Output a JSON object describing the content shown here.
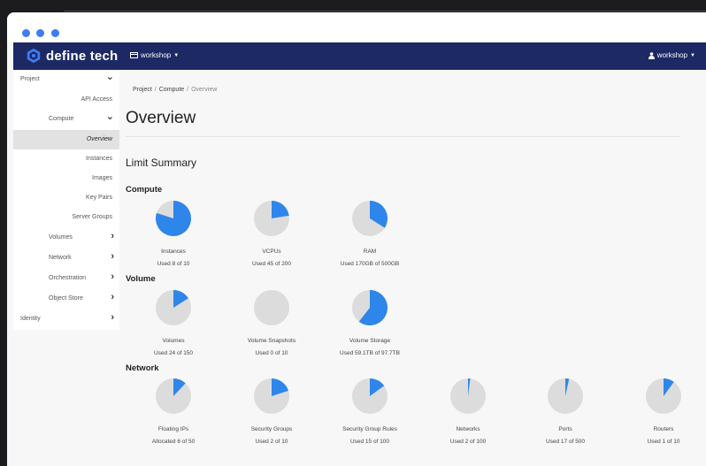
{
  "window": {
    "controls": [
      "close",
      "minimize",
      "maximize"
    ],
    "accent": "#3f7cf2"
  },
  "navbar": {
    "brand": "define tech",
    "project_menu": "workshop",
    "user_menu": "workshop",
    "bg": "#1c2965"
  },
  "sidebar": {
    "items": [
      {
        "label": "Project",
        "level": 0,
        "chevron": "down"
      },
      {
        "label": "API Access",
        "level": 2
      },
      {
        "label": "Compute",
        "level": 1,
        "chevron": "down"
      },
      {
        "label": "Overview",
        "level": 2,
        "active": true
      },
      {
        "label": "Instances",
        "level": 2
      },
      {
        "label": "Images",
        "level": 2
      },
      {
        "label": "Key Pairs",
        "level": 2
      },
      {
        "label": "Server Groups",
        "level": 2
      },
      {
        "label": "Volumes",
        "level": 1,
        "chevron": "right"
      },
      {
        "label": "Network",
        "level": 1,
        "chevron": "right"
      },
      {
        "label": "Orchestration",
        "level": 1,
        "chevron": "right"
      },
      {
        "label": "Object Store",
        "level": 1,
        "chevron": "right"
      },
      {
        "label": "Identity",
        "level": 0,
        "chevron": "right"
      }
    ]
  },
  "breadcrumb": [
    "Project",
    "Compute",
    "Overview"
  ],
  "page_title": "Overview",
  "limit_summary": {
    "title": "Limit Summary",
    "pie_color": "#2f86ea",
    "pie_bg": "#dcdcdc",
    "sections": [
      {
        "title": "Compute",
        "charts": [
          {
            "name": "Instances",
            "used_text": "Used 8 of 10",
            "used": 8,
            "total": 10
          },
          {
            "name": "VCPUs",
            "used_text": "Used 45 of 200",
            "used": 45,
            "total": 200
          },
          {
            "name": "RAM",
            "used_text": "Used 170GB of 500GB",
            "used": 170,
            "total": 500
          }
        ]
      },
      {
        "title": "Volume",
        "charts": [
          {
            "name": "Volumes",
            "used_text": "Used 24 of 150",
            "used": 24,
            "total": 150
          },
          {
            "name": "Volume Snapshots",
            "used_text": "Used 0 of 10",
            "used": 0,
            "total": 10
          },
          {
            "name": "Volume Storage",
            "used_text": "Used 59.1TB of 97.7TB",
            "used": 59.1,
            "total": 97.7
          }
        ]
      },
      {
        "title": "Network",
        "charts": [
          {
            "name": "Floating IPs",
            "used_text": "Allocated 6 of 50",
            "used": 6,
            "total": 50
          },
          {
            "name": "Security Groups",
            "used_text": "Used 2 of 10",
            "used": 2,
            "total": 10
          },
          {
            "name": "Security Group Rules",
            "used_text": "Used 15 of 100",
            "used": 15,
            "total": 100
          },
          {
            "name": "Networks",
            "used_text": "Used 2 of 100",
            "used": 2,
            "total": 100
          },
          {
            "name": "Ports",
            "used_text": "Used 17 of 500",
            "used": 17,
            "total": 500
          },
          {
            "name": "Routers",
            "used_text": "Used 1 of 10",
            "used": 1,
            "total": 10
          }
        ]
      }
    ]
  }
}
